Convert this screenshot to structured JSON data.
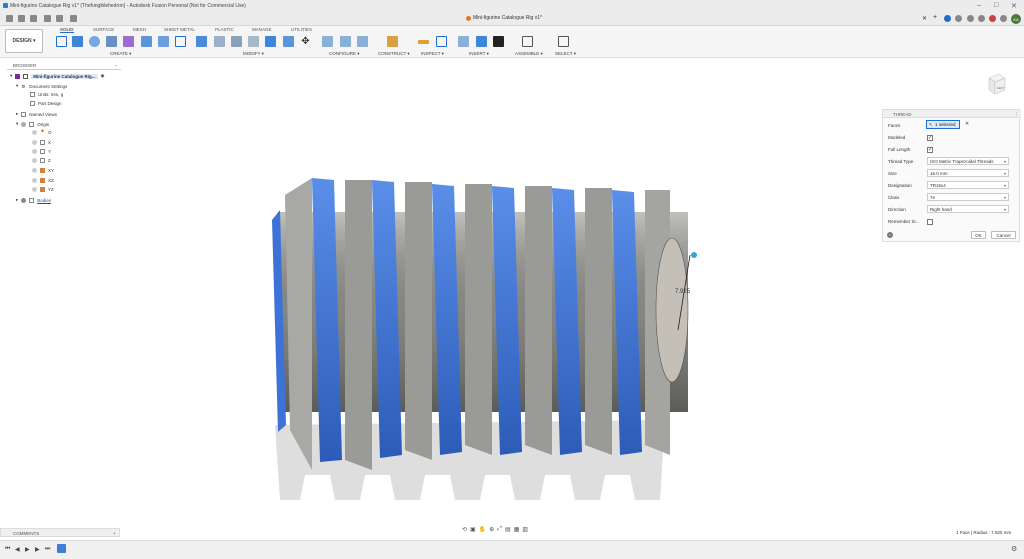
{
  "window": {
    "title": "Mini-figurine Catalogue Rig v1* (Thefungiblehedron) - Autodesk Fusion Personal (Not for Commercial Use)"
  },
  "doc_tab": {
    "label": "Mini-figurine Catalogue Rig v1*"
  },
  "user": {
    "initials": "KA"
  },
  "workspace": {
    "label": "DESIGN"
  },
  "workspace_tabs": [
    "SOLID",
    "SURFACE",
    "MESH",
    "SHEET METAL",
    "PLASTIC",
    "MANAGE",
    "UTILITIES"
  ],
  "tool_groups": [
    "CREATE",
    "MODIFY",
    "CONFIGURE",
    "CONSTRUCT",
    "INSPECT",
    "INSERT",
    "ASSEMBLE",
    "SELECT"
  ],
  "browser": {
    "header": "BROWSER",
    "root": "Mini-figurine Catalogue Rig...",
    "items": [
      {
        "label": "Document Settings"
      },
      {
        "label": "Units: mm, g"
      },
      {
        "label": "Part Design"
      },
      {
        "label": "Named Views"
      },
      {
        "label": "Origin"
      },
      {
        "label": "O"
      },
      {
        "label": "X"
      },
      {
        "label": "Y"
      },
      {
        "label": "Z"
      },
      {
        "label": "XY"
      },
      {
        "label": "XZ"
      },
      {
        "label": "YZ"
      },
      {
        "label": "Bodies"
      }
    ]
  },
  "thread_panel": {
    "title": "THREAD",
    "faces_label": "Faces",
    "faces_value": "1 selected",
    "modeled_label": "Modeled",
    "full_length_label": "Full Length",
    "thread_type_label": "Thread Type",
    "thread_type_value": "ISO Metric Trapezoidal Threads",
    "size_label": "Size",
    "size_value": "16.0 mm",
    "designation_label": "Designation",
    "designation_value": "TR16x4",
    "class_label": "Class",
    "class_value": "7e",
    "direction_label": "Direction",
    "direction_value": "Right hand",
    "remember_label": "Remember Si...",
    "ok_label": "OK",
    "cancel_label": "Cancel"
  },
  "viewport": {
    "dimension_label": "7.925"
  },
  "comments": {
    "label": "COMMENTS"
  },
  "status": {
    "text": "1 Face | Radius : 7.925 mm"
  },
  "colors": {
    "thread_blue": "#3d72d6",
    "core_gray": "#8a8a86"
  }
}
